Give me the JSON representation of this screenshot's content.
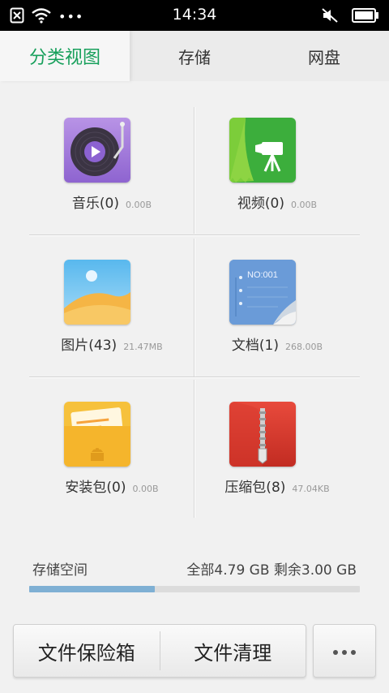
{
  "status_bar": {
    "time": "14:34",
    "left_icons": [
      "sim-card-off-icon",
      "wifi-icon",
      "overflow-dots-icon"
    ],
    "right_icons": [
      "mute-icon",
      "battery-icon"
    ]
  },
  "tabs": [
    {
      "label": "分类视图",
      "active": true
    },
    {
      "label": "存储",
      "active": false
    },
    {
      "label": "网盘",
      "active": false
    }
  ],
  "categories": [
    {
      "name": "音乐(0)",
      "size": "0.00B",
      "icon": "music-icon"
    },
    {
      "name": "视频(0)",
      "size": "0.00B",
      "icon": "video-icon"
    },
    {
      "name": "图片(43)",
      "size": "21.47MB",
      "icon": "image-icon"
    },
    {
      "name": "文档(1)",
      "size": "268.00B",
      "icon": "document-icon",
      "icon_text": "NO:001"
    },
    {
      "name": "安装包(0)",
      "size": "0.00B",
      "icon": "apk-icon"
    },
    {
      "name": "压缩包(8)",
      "size": "47.04KB",
      "icon": "archive-icon"
    }
  ],
  "storage": {
    "title": "存储空间",
    "info": "全部4.79 GB  剩余3.00 GB",
    "used_fraction": 0.38
  },
  "buttons": {
    "vault": "文件保险箱",
    "clean": "文件清理",
    "more": "more-icon"
  },
  "colors": {
    "accent": "#18a05c",
    "bar_fill": "#7fb0d4"
  }
}
